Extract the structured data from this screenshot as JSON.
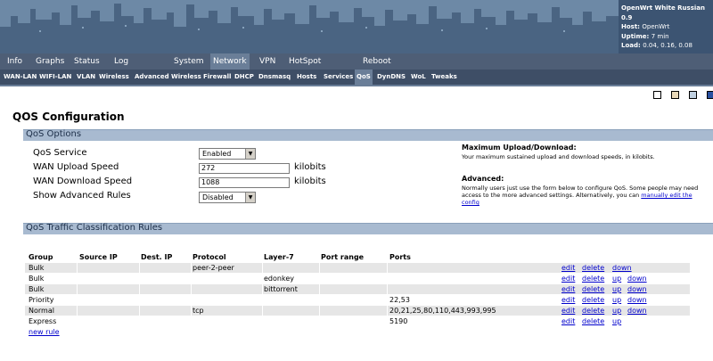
{
  "header": {
    "title": "OpenWrt White Russian 0.9",
    "host_label": "Host:",
    "host_value": "OpenWrt",
    "uptime_label": "Uptime:",
    "uptime_value": "7 min",
    "load_label": "Load:",
    "load_value": "0.04, 0.16, 0.08"
  },
  "mainmenu": [
    "Info",
    "Graphs",
    "Status",
    "Log",
    "System",
    "Network",
    "VPN",
    "HotSpot",
    "Reboot"
  ],
  "submenu": [
    "WAN-LAN",
    "WIFI-LAN",
    "VLAN",
    "Wireless",
    "Advanced Wireless",
    "Firewall",
    "DHCP",
    "Dnsmasq",
    "Hosts",
    "Services",
    "QoS",
    "DynDNS",
    "WoL",
    "Tweaks"
  ],
  "swatch_colors": [
    "#ffffff",
    "#e8d8b8",
    "#c0d0e0",
    "#2850a0"
  ],
  "page_title": "QOS Configuration",
  "options": {
    "section_title": "QoS Options",
    "qos_service_label": "QoS Service",
    "qos_service_value": "Enabled",
    "upload_label": "WAN Upload Speed",
    "upload_value": "272",
    "upload_unit": "kilobits",
    "download_label": "WAN Download Speed",
    "download_value": "1088",
    "download_unit": "kilobits",
    "advanced_label": "Show Advanced Rules",
    "advanced_value": "Disabled"
  },
  "help": {
    "maxud_title": "Maximum Upload/Download:",
    "maxud_text": "Your maximum sustained upload and download speeds, in kilobits.",
    "adv_title": "Advanced:",
    "adv_text": "Normally users just use the form below to configure QoS. Some people may need access to the more advanced settings. Alternatively, you can",
    "adv_link": "manually edit the config"
  },
  "rules": {
    "section_title": "QoS Traffic Classification Rules",
    "columns": [
      "Group",
      "Source IP",
      "Dest. IP",
      "Protocol",
      "Layer-7",
      "Port range",
      "Ports"
    ],
    "rows": [
      {
        "group": "Bulk",
        "src": "",
        "dst": "",
        "proto": "peer-2-peer",
        "l7": "",
        "range": "",
        "ports": "",
        "actions": [
          "edit",
          "delete",
          "down"
        ]
      },
      {
        "group": "Bulk",
        "src": "",
        "dst": "",
        "proto": "",
        "l7": "edonkey",
        "range": "",
        "ports": "",
        "actions": [
          "edit",
          "delete",
          "up",
          "down"
        ]
      },
      {
        "group": "Bulk",
        "src": "",
        "dst": "",
        "proto": "",
        "l7": "bittorrent",
        "range": "",
        "ports": "",
        "actions": [
          "edit",
          "delete",
          "up",
          "down"
        ]
      },
      {
        "group": "Priority",
        "src": "",
        "dst": "",
        "proto": "",
        "l7": "",
        "range": "",
        "ports": "22,53",
        "actions": [
          "edit",
          "delete",
          "up",
          "down"
        ]
      },
      {
        "group": "Normal",
        "src": "",
        "dst": "",
        "proto": "tcp",
        "l7": "",
        "range": "",
        "ports": "20,21,25,80,110,443,993,995",
        "actions": [
          "edit",
          "delete",
          "up",
          "down"
        ]
      },
      {
        "group": "Express",
        "src": "",
        "dst": "",
        "proto": "",
        "l7": "",
        "range": "",
        "ports": "5190",
        "actions": [
          "edit",
          "delete",
          "up"
        ]
      }
    ],
    "new_rule": "new rule"
  }
}
